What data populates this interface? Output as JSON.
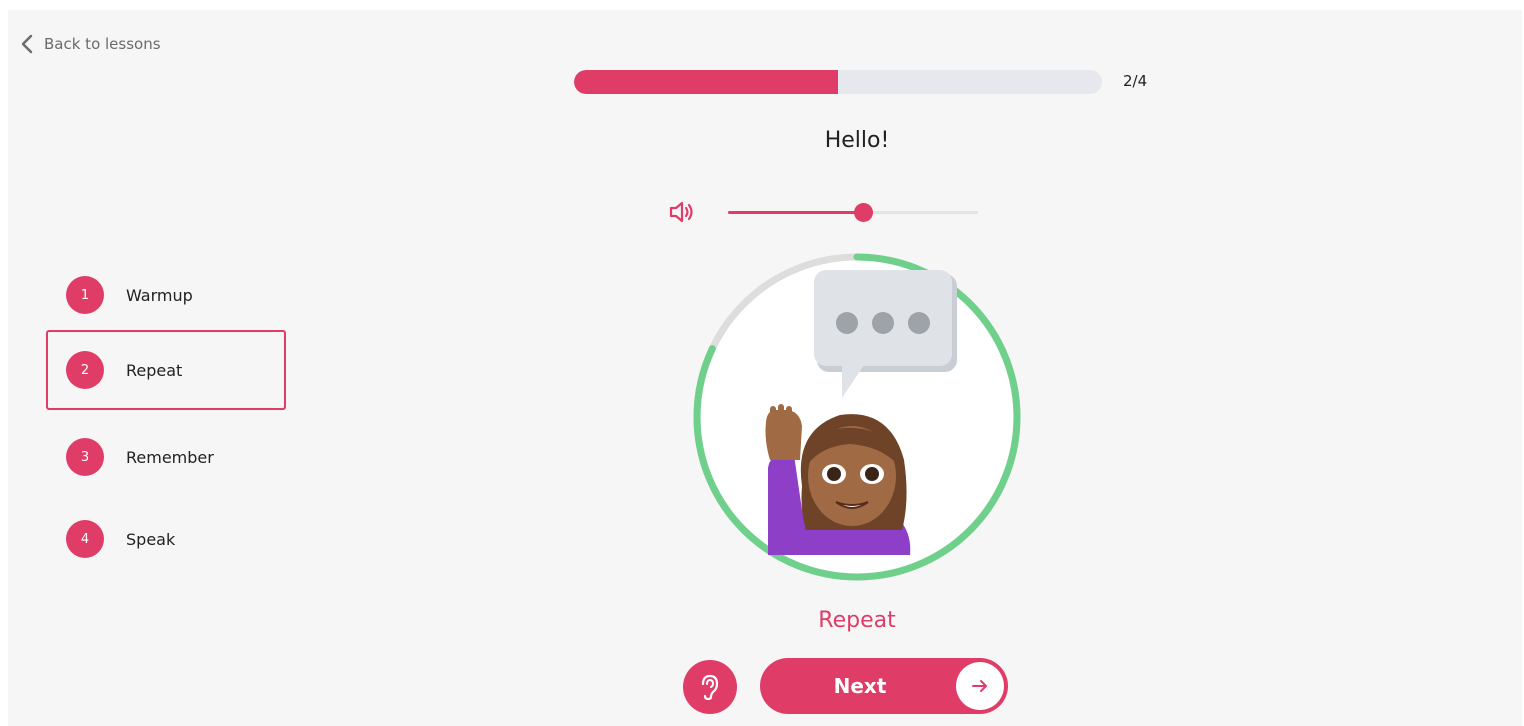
{
  "nav": {
    "back_label": "Back to lessons"
  },
  "progress": {
    "current": 2,
    "total": 4,
    "label": "2/4",
    "fraction": 0.5
  },
  "phrase": "Hello!",
  "volume": {
    "level": 0.54
  },
  "steps": [
    {
      "number": "1",
      "label": "Warmup",
      "active": false
    },
    {
      "number": "2",
      "label": "Repeat",
      "active": true
    },
    {
      "number": "3",
      "label": "Remember",
      "active": false
    },
    {
      "number": "4",
      "label": "Speak",
      "active": false
    }
  ],
  "timer_ring": {
    "progress_fraction": 0.82
  },
  "mode_label": "Repeat",
  "actions": {
    "next_label": "Next",
    "listen_icon": "ear-icon",
    "next_icon": "arrow-right-icon"
  },
  "colors": {
    "accent": "#e03c68",
    "ring": "#6fd08c",
    "ring_track": "#dddddd"
  }
}
